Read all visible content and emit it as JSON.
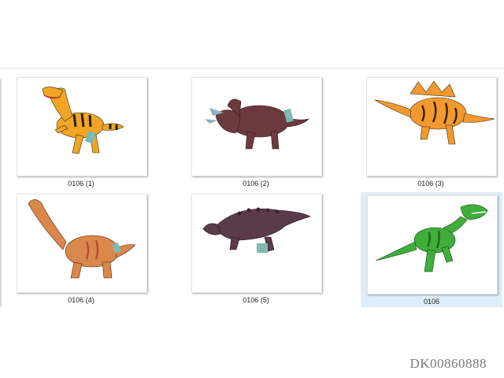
{
  "files": [
    {
      "name": "0106 (1)",
      "icon": "velociraptor-thumbnail",
      "selected": false
    },
    {
      "name": "0106 (2)",
      "icon": "triceratops-thumbnail",
      "selected": false
    },
    {
      "name": "0106 (3)",
      "icon": "stegosaurus-thumbnail",
      "selected": false
    },
    {
      "name": "0106 (4)",
      "icon": "brachiosaurus-thumbnail",
      "selected": false
    },
    {
      "name": "0106 (5)",
      "icon": "ankylosaurus-thumbnail",
      "selected": false
    },
    {
      "name": "0106",
      "icon": "tyrannosaurus-thumbnail",
      "selected": true
    }
  ],
  "colors": {
    "selection": "#dceefb",
    "raptor": "#f0a526",
    "triceratops": "#6b3a3f",
    "stegosaurus": "#f29a2e",
    "brachiosaurus": "#d9874a",
    "ankylosaurus": "#5b3a4a",
    "trex": "#3fae3a"
  },
  "watermark": "DK00860888"
}
